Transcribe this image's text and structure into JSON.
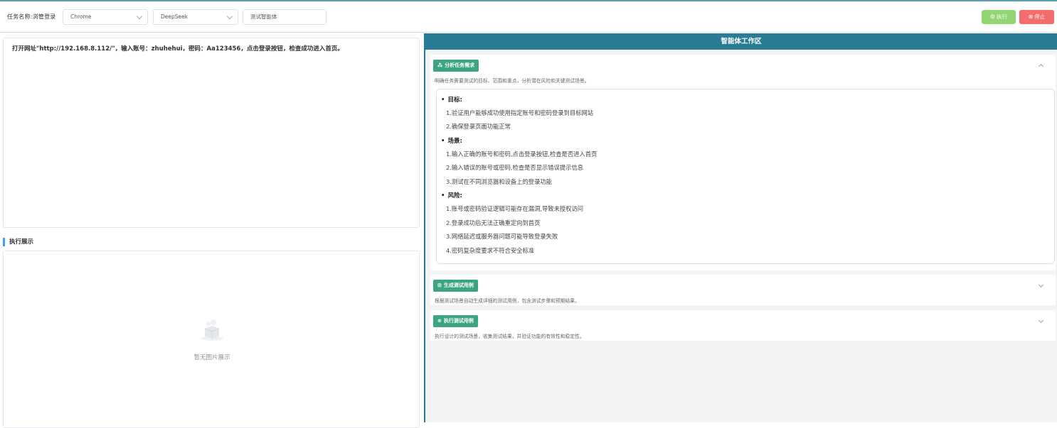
{
  "toolbar": {
    "task_label": "任务名称:浏管登录",
    "browser_select": "Chrome",
    "model_select": "DeepSeek",
    "agent_input": "测试智能体",
    "run_label": "执行",
    "stop_label": "停止",
    "run_icon": "gear-icon",
    "stop_icon": "stop-circle-icon"
  },
  "left": {
    "prompt_text": "打开网址\"http://192.168.8.112/\"，输入账号：zhuhehui，密码：Aa123456，点击登录按钮，检查成功进入首页。",
    "exec_title": "执行展示",
    "empty_text": "暂无图片展示"
  },
  "right": {
    "header": "智能体工作区",
    "sections": [
      {
        "tag": "分析任务需求",
        "icon": "cluster-icon",
        "desc": "明确任务需要测试的目标、范围和重点，分析潜在风险和关键测试场景。",
        "expanded": true,
        "groups": [
          {
            "title": "目标:",
            "items": [
              "1.验证用户能够成功使用指定账号和密码登录到目标网站",
              "2.确保登录页面功能正常"
            ]
          },
          {
            "title": "场景:",
            "items": [
              "1.输入正确的账号和密码,点击登录按钮,检查是否进入首页",
              "2.输入错误的账号或密码,检查是否显示错误提示信息",
              "3.测试在不同浏览器和设备上的登录功能"
            ]
          },
          {
            "title": "风险:",
            "items": [
              "1.账号或密码验证逻辑可能存在漏洞,导致未授权访问",
              "2.登录成功后无法正确重定向到首页",
              "3.网络延迟或服务器问题可能导致登录失败",
              "4.密码复杂度要求不符合安全标准"
            ]
          }
        ]
      },
      {
        "tag": "生成测试用例",
        "icon": "grid-icon",
        "desc": "根据测试场景自动生成详细的测试用例，包含测试步骤和预期结果。",
        "expanded": false
      },
      {
        "tag": "执行测试用例",
        "icon": "play-circle-icon",
        "desc": "执行设计的测试场景，收集测试结果，并验证功能的有效性和稳定性。",
        "expanded": false
      }
    ]
  }
}
